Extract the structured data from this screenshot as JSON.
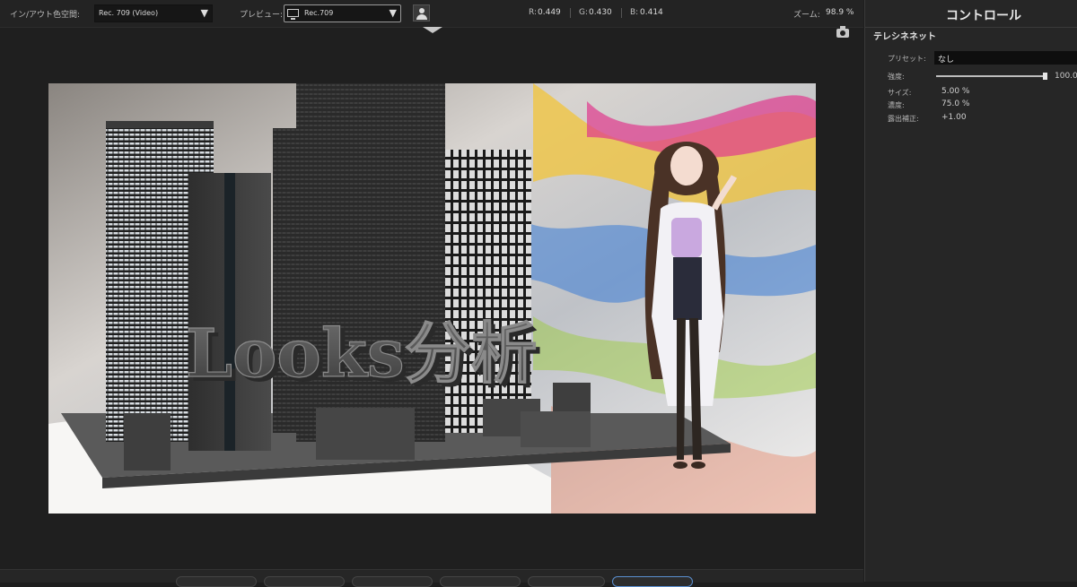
{
  "toolbar": {
    "in_out_label": "イン/アウト色空間:",
    "in_out_value": "Rec. 709 (Video)",
    "preview_label": "プレビュー:",
    "preview_value": "Rec.709",
    "r_label": "R:",
    "r_value": "0.449",
    "g_label": "G:",
    "g_value": "0.430",
    "b_label": "B:",
    "b_value": "0.414",
    "zoom_label": "ズーム:",
    "zoom_value": "98.9 %"
  },
  "preview": {
    "title_text": "Looks分析"
  },
  "panel": {
    "title": "コントロール",
    "effect_name": "テレシネネット",
    "preset_label": "プリセット:",
    "preset_value": "なし",
    "strength_label": "強度:",
    "strength_value": "100.0",
    "strength_fraction": 1.0,
    "size_label": "サイズ:",
    "size_value": "5.00 %",
    "density_label": "濃度:",
    "density_value": "75.0 %",
    "exposure_label": "露出補正:",
    "exposure_value": "+1.00"
  },
  "colors": {
    "accent": "#5a8fd0",
    "background": "#1e1e1e",
    "panel": "#262626"
  },
  "icons": [
    "chevron-down-icon",
    "monitor-icon",
    "person-icon",
    "camera-icon",
    "triangle-down-icon"
  ]
}
